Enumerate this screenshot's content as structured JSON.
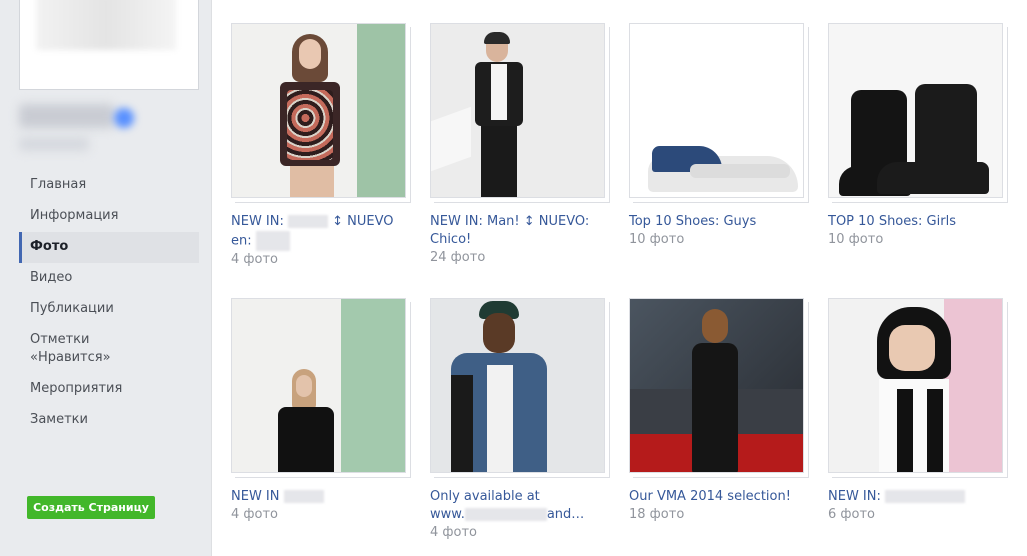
{
  "sidebar": {
    "nav": [
      {
        "label": "Главная"
      },
      {
        "label": "Информация"
      },
      {
        "label": "Фото"
      },
      {
        "label": "Видео"
      },
      {
        "label": "Публикации"
      },
      {
        "label": "Отметки «Нравится»"
      },
      {
        "label": "Мероприятия"
      },
      {
        "label": "Заметки"
      }
    ],
    "create_page_label": "Создать Страницу"
  },
  "albums": [
    {
      "title_a": "NEW IN:",
      "title_b": "↕ NUEVO",
      "title_c": "en:",
      "count": "4 фото"
    },
    {
      "title": "NEW IN: Man! ↕ NUEVO: Chico!",
      "count": "24 фото"
    },
    {
      "title": "Top 10 Shoes: Guys",
      "count": "10 фото"
    },
    {
      "title": "TOP 10 Shoes: Girls",
      "count": "10 фото"
    },
    {
      "title": "NEW IN",
      "count": "4 фото"
    },
    {
      "title_a": "Only available at",
      "title_b": "www.",
      "title_c": "and…",
      "count": "4 фото"
    },
    {
      "title": "Our VMA 2014 selection!",
      "count": "18 фото"
    },
    {
      "title": "NEW IN:",
      "count": "6 фото"
    }
  ],
  "colors": {
    "link": "#365899",
    "meta": "#90949c",
    "accent": "#4267b2",
    "button": "#42b72a"
  }
}
